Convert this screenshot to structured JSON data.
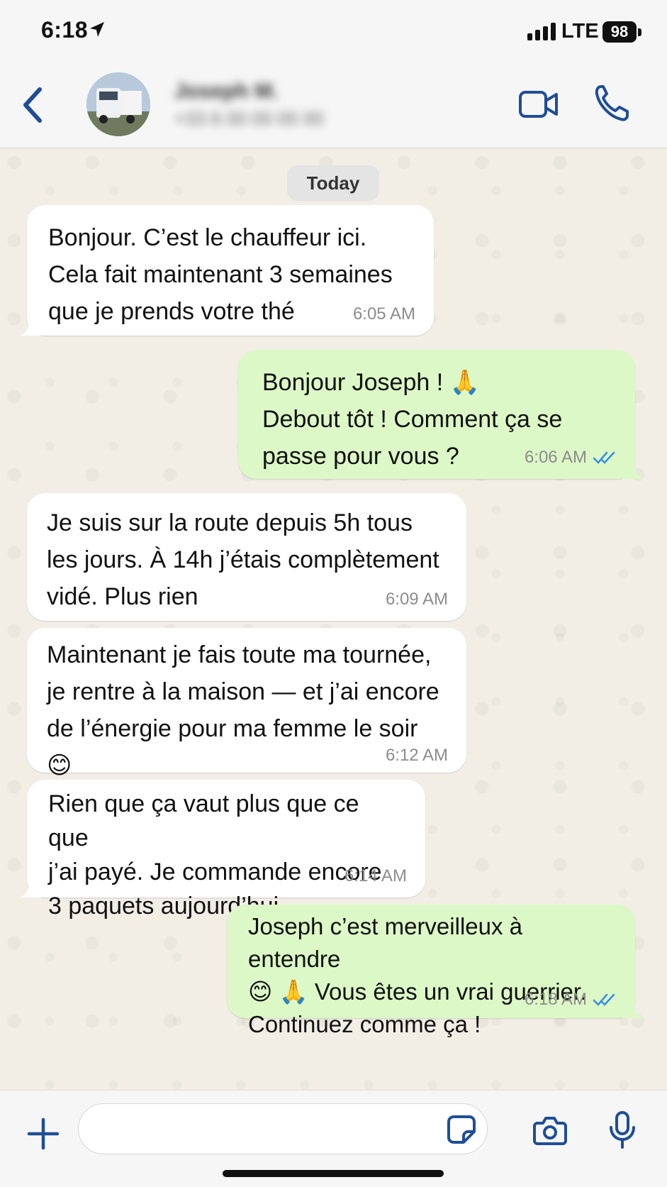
{
  "status_bar": {
    "time": "6:18",
    "network": "LTE",
    "battery": "98"
  },
  "header": {
    "contact_name": "Joseph M.",
    "contact_subtitle": "+33 6 00 00 00 00"
  },
  "chat": {
    "date_label": "Today",
    "messages": [
      {
        "direction": "in",
        "text": "Bonjour. C’est le chauffeur ici.\nCela fait maintenant 3 semaines\nque je prends votre thé",
        "time": "6:05 AM"
      },
      {
        "direction": "out",
        "text": "Bonjour Joseph ! 🙏\nDebout tôt ! Comment ça se\npasse pour vous ?",
        "time": "6:06 AM",
        "status": "read"
      },
      {
        "direction": "in",
        "text": "Je suis sur la route depuis 5h tous\nles jours. À 14h j’étais complètement\nvidé. Plus rien",
        "time": "6:09 AM"
      },
      {
        "direction": "in",
        "text": "Maintenant je fais toute ma tournée,\nje rentre à la maison — et j’ai encore\nde l’énergie pour ma femme le soir 😊",
        "time": "6:12 AM"
      },
      {
        "direction": "in",
        "text": "Rien que ça vaut plus que ce que\nj’ai payé. Je commande encore\n3 paquets aujourd’hui",
        "time": "6:14 AM"
      },
      {
        "direction": "out",
        "text": "Joseph c’est merveilleux à entendre\n😊 🙏 Vous êtes un vrai guerrier.\nContinuez comme ça !",
        "time": "6:18 AM",
        "status": "read"
      }
    ]
  },
  "input_bar": {
    "message_value": "",
    "message_placeholder": ""
  },
  "colors": {
    "accent": "#1f4e96",
    "incoming_bubble": "#ffffff",
    "outgoing_bubble": "#dcf8c6",
    "read_ticks": "#3b8fe0",
    "chat_background": "#f2eee6"
  },
  "icons": [
    "location-arrow-icon",
    "signal-icon",
    "battery-icon",
    "back-chevron-icon",
    "video-camera-icon",
    "phone-icon",
    "double-check-icon",
    "plus-icon",
    "sticker-icon",
    "camera-icon",
    "microphone-icon"
  ]
}
